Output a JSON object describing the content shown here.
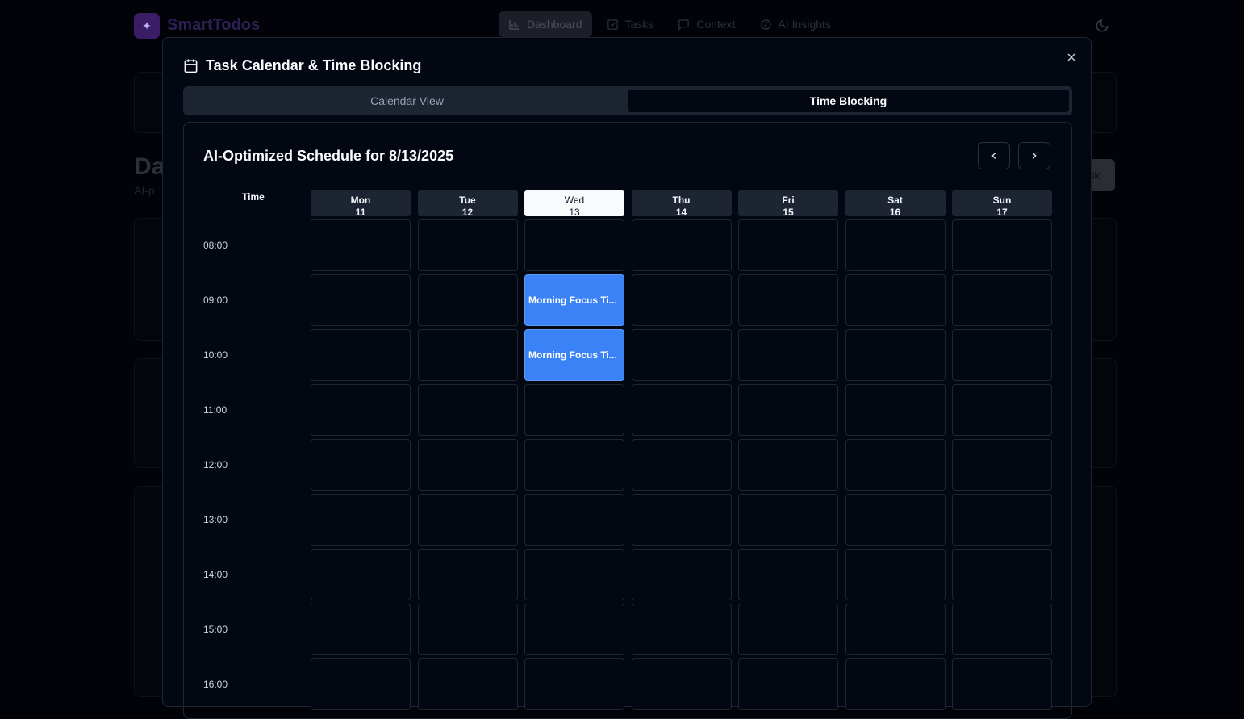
{
  "app": {
    "brand": "SmartTodos",
    "nav": [
      {
        "label": "Dashboard",
        "icon": "bar-chart-icon"
      },
      {
        "label": "Tasks",
        "icon": "check-square-icon"
      },
      {
        "label": "Context",
        "icon": "message-square-icon"
      },
      {
        "label": "AI Insights",
        "icon": "brain-icon"
      }
    ],
    "active_nav": "Dashboard",
    "bg_title": "Da",
    "bg_subtitle": "AI-p",
    "bg_button": "sk"
  },
  "modal": {
    "title": "Task Calendar & Time Blocking",
    "tabs": [
      {
        "label": "Calendar View",
        "active": false
      },
      {
        "label": "Time Blocking",
        "active": true
      }
    ],
    "schedule_title": "AI-Optimized Schedule for 8/13/2025",
    "time_header": "Time",
    "days": [
      {
        "name": "Mon",
        "date": "11",
        "today": false
      },
      {
        "name": "Tue",
        "date": "12",
        "today": false
      },
      {
        "name": "Wed",
        "date": "13",
        "today": true
      },
      {
        "name": "Thu",
        "date": "14",
        "today": false
      },
      {
        "name": "Fri",
        "date": "15",
        "today": false
      },
      {
        "name": "Sat",
        "date": "16",
        "today": false
      },
      {
        "name": "Sun",
        "date": "17",
        "today": false
      }
    ],
    "times": [
      "08:00",
      "09:00",
      "10:00",
      "11:00",
      "12:00",
      "13:00",
      "14:00",
      "15:00",
      "16:00"
    ],
    "events": [
      {
        "day": "Wed",
        "time": "09:00",
        "label": "Morning Focus Ti..."
      },
      {
        "day": "Wed",
        "time": "10:00",
        "label": "Morning Focus Ti..."
      }
    ],
    "colors": {
      "event": "#3b82f6",
      "today_header": "#f8fafc"
    }
  }
}
